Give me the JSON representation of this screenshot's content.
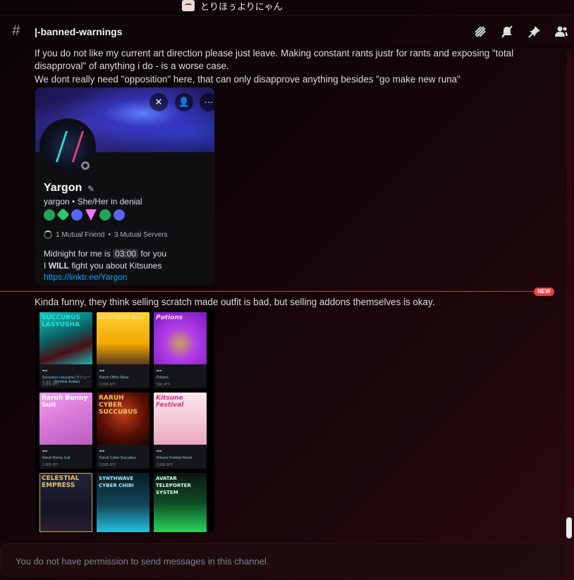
{
  "server": {
    "name": "とりほぅよりにゃん"
  },
  "channel": {
    "name": "|-banned-warnings"
  },
  "header_icons": [
    "threads-icon",
    "mute-icon",
    "pin-icon",
    "members-icon"
  ],
  "messages": {
    "line1": "If you do not like my current art direction please just leave. Making constant rants justr for rants and exposing \"total",
    "line2": "disapproval\" of anything i do - is a worse case.",
    "line3": "We dont really need \"opposition\" here, that can only disapprove anything besides \"go make new runa\"",
    "line4": "Kinda funny, they think selling scratch made outfit is bad, but selling addons themselves is okay."
  },
  "profile_card": {
    "name": "Yargon",
    "username": "yargon",
    "pronouns": "She/Her in denial",
    "mutual_friends": "1 Mutual Friend",
    "mutual_servers": "3 Mutual Servers",
    "bio_line1_pre": "Midnight for me is",
    "bio_time": "03:00",
    "bio_line1_post": "for you",
    "bio_line2_pre": "I",
    "bio_line2_bold": "WILL",
    "bio_line2_post": "fight you about Kitsunes",
    "link": "https://linktr.ee/Yargon",
    "badge_colors": [
      "#23a559",
      "#2dc770",
      "#5865f2",
      "#ff73fa",
      "#23a559",
      "#5865f2"
    ]
  },
  "divider": {
    "label": "NEW"
  },
  "products": [
    {
      "title": "SUCCUBUS LASYUSHA",
      "caption": "Succubus Lasyusha (ラシューシャ) - (Modular Avatar)",
      "price": "2,000 JPY",
      "color": "#1bb5b0"
    },
    {
      "title": "Raruh Office Wear",
      "caption": "Raruh Office Wear",
      "price": "2,000 JPY",
      "color": "#f2b400"
    },
    {
      "title": "Potions",
      "caption": "Potions",
      "price": "500 JPY",
      "color": "#b22ce0"
    },
    {
      "title": "Raruh Bunny Suit",
      "caption": "Raruh Bunny Suit",
      "price": "2,000 JPY",
      "color": "#e88ee8"
    },
    {
      "title": "RARUH CYBER SUCCUBUS",
      "caption": "Raruh Cyber Succubus",
      "price": "2,000 JPY",
      "color": "#7a1a08"
    },
    {
      "title": "Kitsune Festival",
      "caption": "Kitsune Festival Raruh",
      "price": "2,000 JPY",
      "color": "#f4d6e2"
    },
    {
      "title": "CELESTIAL EMPRESS",
      "caption": "",
      "price": "",
      "color": "#1c1c2e"
    },
    {
      "title": "SYNTHWAVE CYBER CHIBI",
      "caption": "",
      "price": "",
      "color": "#0f2a35"
    },
    {
      "title": "AVATAR TELEPORTER SYSTEM",
      "caption": "",
      "price": "",
      "color": "#0c2a18"
    }
  ],
  "composer": {
    "placeholder": "You do not have permission to send messages in this channel."
  }
}
